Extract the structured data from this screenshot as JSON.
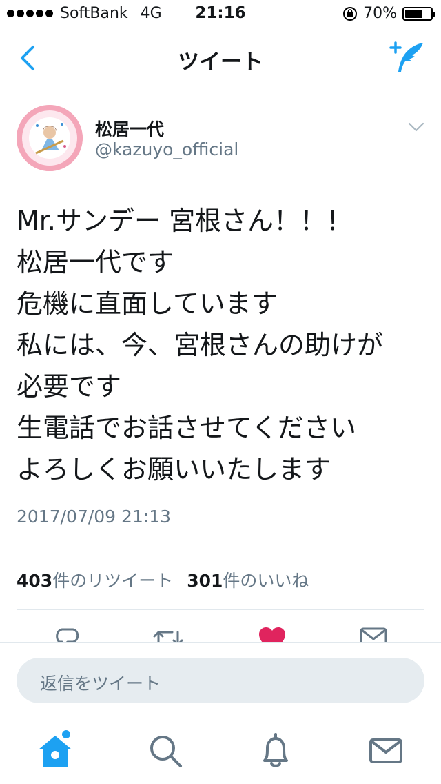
{
  "status_bar": {
    "carrier": "SoftBank",
    "network": "4G",
    "time": "21:16",
    "battery_percent": "70%",
    "battery_level": 0.7
  },
  "nav": {
    "title": "ツイート",
    "back_icon": "chevron-left-icon",
    "compose_icon": "compose-tweet-icon"
  },
  "tweet": {
    "display_name": "松居一代",
    "handle": "@kazuyo_official",
    "text": "Mr.サンデー 宮根さん！！！\n松居一代です\n危機に直面しています\n私には、今、宮根さんの助けが\n必要です\n生電話でお話させてください\nよろしくお願いいたします",
    "timestamp": "2017/07/09 21:13",
    "retweet_count": "403",
    "retweet_label": "件のリツイート",
    "like_count": "301",
    "like_label": "件のいいね",
    "liked": true
  },
  "reply": {
    "placeholder": "返信をツイート"
  },
  "tabs": [
    {
      "icon": "home-icon",
      "active": true
    },
    {
      "icon": "search-icon",
      "active": false
    },
    {
      "icon": "bell-icon",
      "active": false
    },
    {
      "icon": "mail-icon",
      "active": false
    }
  ],
  "colors": {
    "accent": "#1da1f2",
    "like": "#e0245e",
    "secondary_text": "#657786",
    "divider": "#e1e8ed"
  }
}
